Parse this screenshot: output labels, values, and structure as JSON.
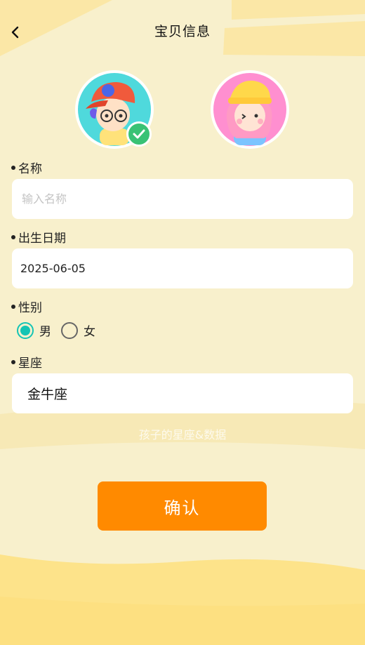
{
  "header": {
    "title": "宝贝信息",
    "back_icon": "chevron-left-icon"
  },
  "avatars": [
    {
      "name": "boy-avatar",
      "selected": true,
      "bg": "#4fd9dc"
    },
    {
      "name": "girl-avatar",
      "selected": false,
      "bg": "#ff8fd0"
    }
  ],
  "form": {
    "name_label": "名称",
    "name_placeholder": "输入名称",
    "name_value": "",
    "birth_label": "出生日期",
    "birth_value": "2025-06-05",
    "gender_label": "性别",
    "gender_options": [
      "男",
      "女"
    ],
    "gender_selected": "男",
    "zodiac_label": "星座",
    "zodiac_value": "金牛座"
  },
  "watermark": "孩子的星座&数据",
  "confirm_label": "确认",
  "colors": {
    "accent": "#ff8a00",
    "radio": "#14c4b4",
    "check": "#39c275",
    "background": "#f8f0cc"
  }
}
